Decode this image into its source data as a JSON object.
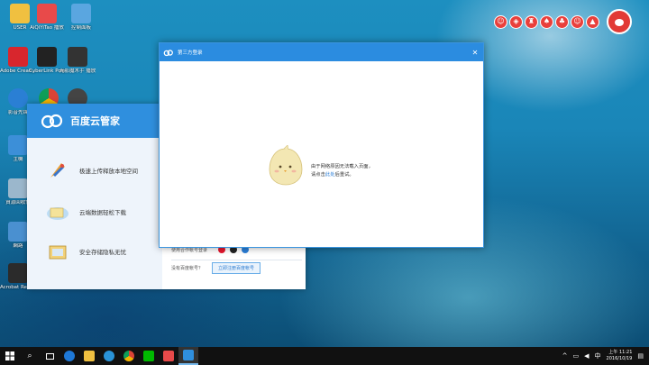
{
  "desktop": {
    "icons": [
      {
        "label": "USER",
        "color": "#f0c040"
      },
      {
        "label": "AiQiYiTao\n播放",
        "color": "#e84a4a"
      },
      {
        "label": "控制面板",
        "color": "#5aa6e0"
      },
      {
        "label": "Adobe\nCreati...",
        "color": "#d8262d"
      },
      {
        "label": "CyberLink\nPowerDV...",
        "color": "#222222"
      },
      {
        "label": "光影魔术手\n播放",
        "color": "#333333"
      },
      {
        "label": "影音先锋",
        "color": "#2a7fd4"
      },
      {
        "label": "",
        "color": "#e6a020"
      },
      {
        "label": "",
        "color": "#444444"
      },
      {
        "label": "主機",
        "color": "#3c8fd8"
      },
      {
        "label": "資源回收筒",
        "color": "#9bb7cc"
      },
      {
        "label": "網路",
        "color": "#4a90d0"
      },
      {
        "label": "Acrobat\nReader DC",
        "color": "#2b2b2b"
      }
    ]
  },
  "top_tools": [
    "☺",
    "◈",
    "♜",
    "♠",
    "♣",
    "☺",
    "▲"
  ],
  "baidu_window": {
    "title": "百度云管家",
    "features": [
      "极速上传释放本地空间",
      "云端数据轻松下载",
      "安全存储隐私无忧"
    ],
    "login_with": "使用合作帐号登录",
    "no_account": "没有百度帐号？",
    "register_button": "立即注册百度帐号"
  },
  "third_party_window": {
    "title": "第三方登录",
    "error_line1": "由于网络原因无法载入页面，",
    "error_line2_prefix": "请点击",
    "error_link": "此处",
    "error_line2_suffix": "后重试。"
  },
  "taskbar": {
    "clock_time": "上午 11:21",
    "clock_date": "2016/10/19",
    "input_lang": "中",
    "tray_chevron": "^"
  }
}
